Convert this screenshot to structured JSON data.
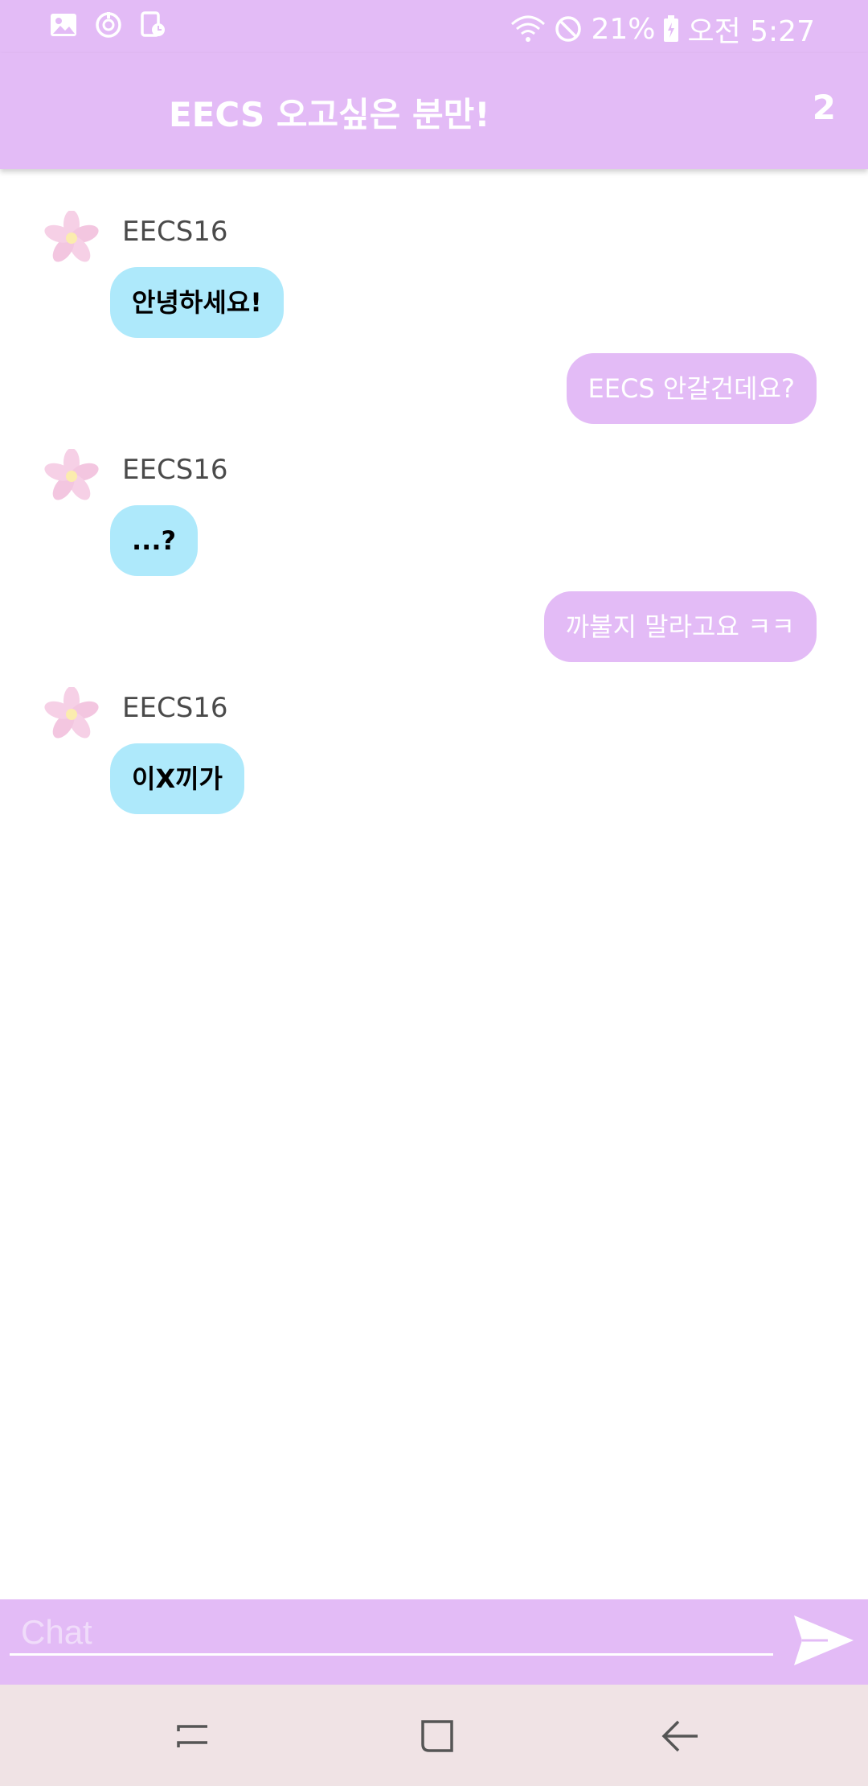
{
  "status_bar": {
    "battery": "21%",
    "time": "오전 5:27",
    "icons": [
      "gallery-icon",
      "sync-icon",
      "screen-timer-icon",
      "wifi-icon",
      "do-not-disturb-icon",
      "battery-icon"
    ]
  },
  "header": {
    "title": "EECS 오고싶은 분만!",
    "member_count": "2"
  },
  "messages": [
    {
      "direction": "incoming",
      "sender": "EECS16",
      "text": "안녕하세요!"
    },
    {
      "direction": "outgoing",
      "text": "EECS 안갈건데요?"
    },
    {
      "direction": "incoming",
      "sender": "EECS16",
      "text": "...?"
    },
    {
      "direction": "outgoing",
      "text": "까불지 말라고요 ㅋㅋ"
    },
    {
      "direction": "incoming",
      "sender": "EECS16",
      "text": "이X끼가"
    }
  ],
  "composer": {
    "placeholder": "Chat",
    "value": ""
  },
  "nav_bar": {
    "icons": [
      "recent-apps-icon",
      "home-icon",
      "back-icon"
    ]
  },
  "colors": {
    "accent": "#e3bbf6",
    "incoming_bubble": "#aee9fb",
    "nav_background": "#f0e3e5"
  }
}
